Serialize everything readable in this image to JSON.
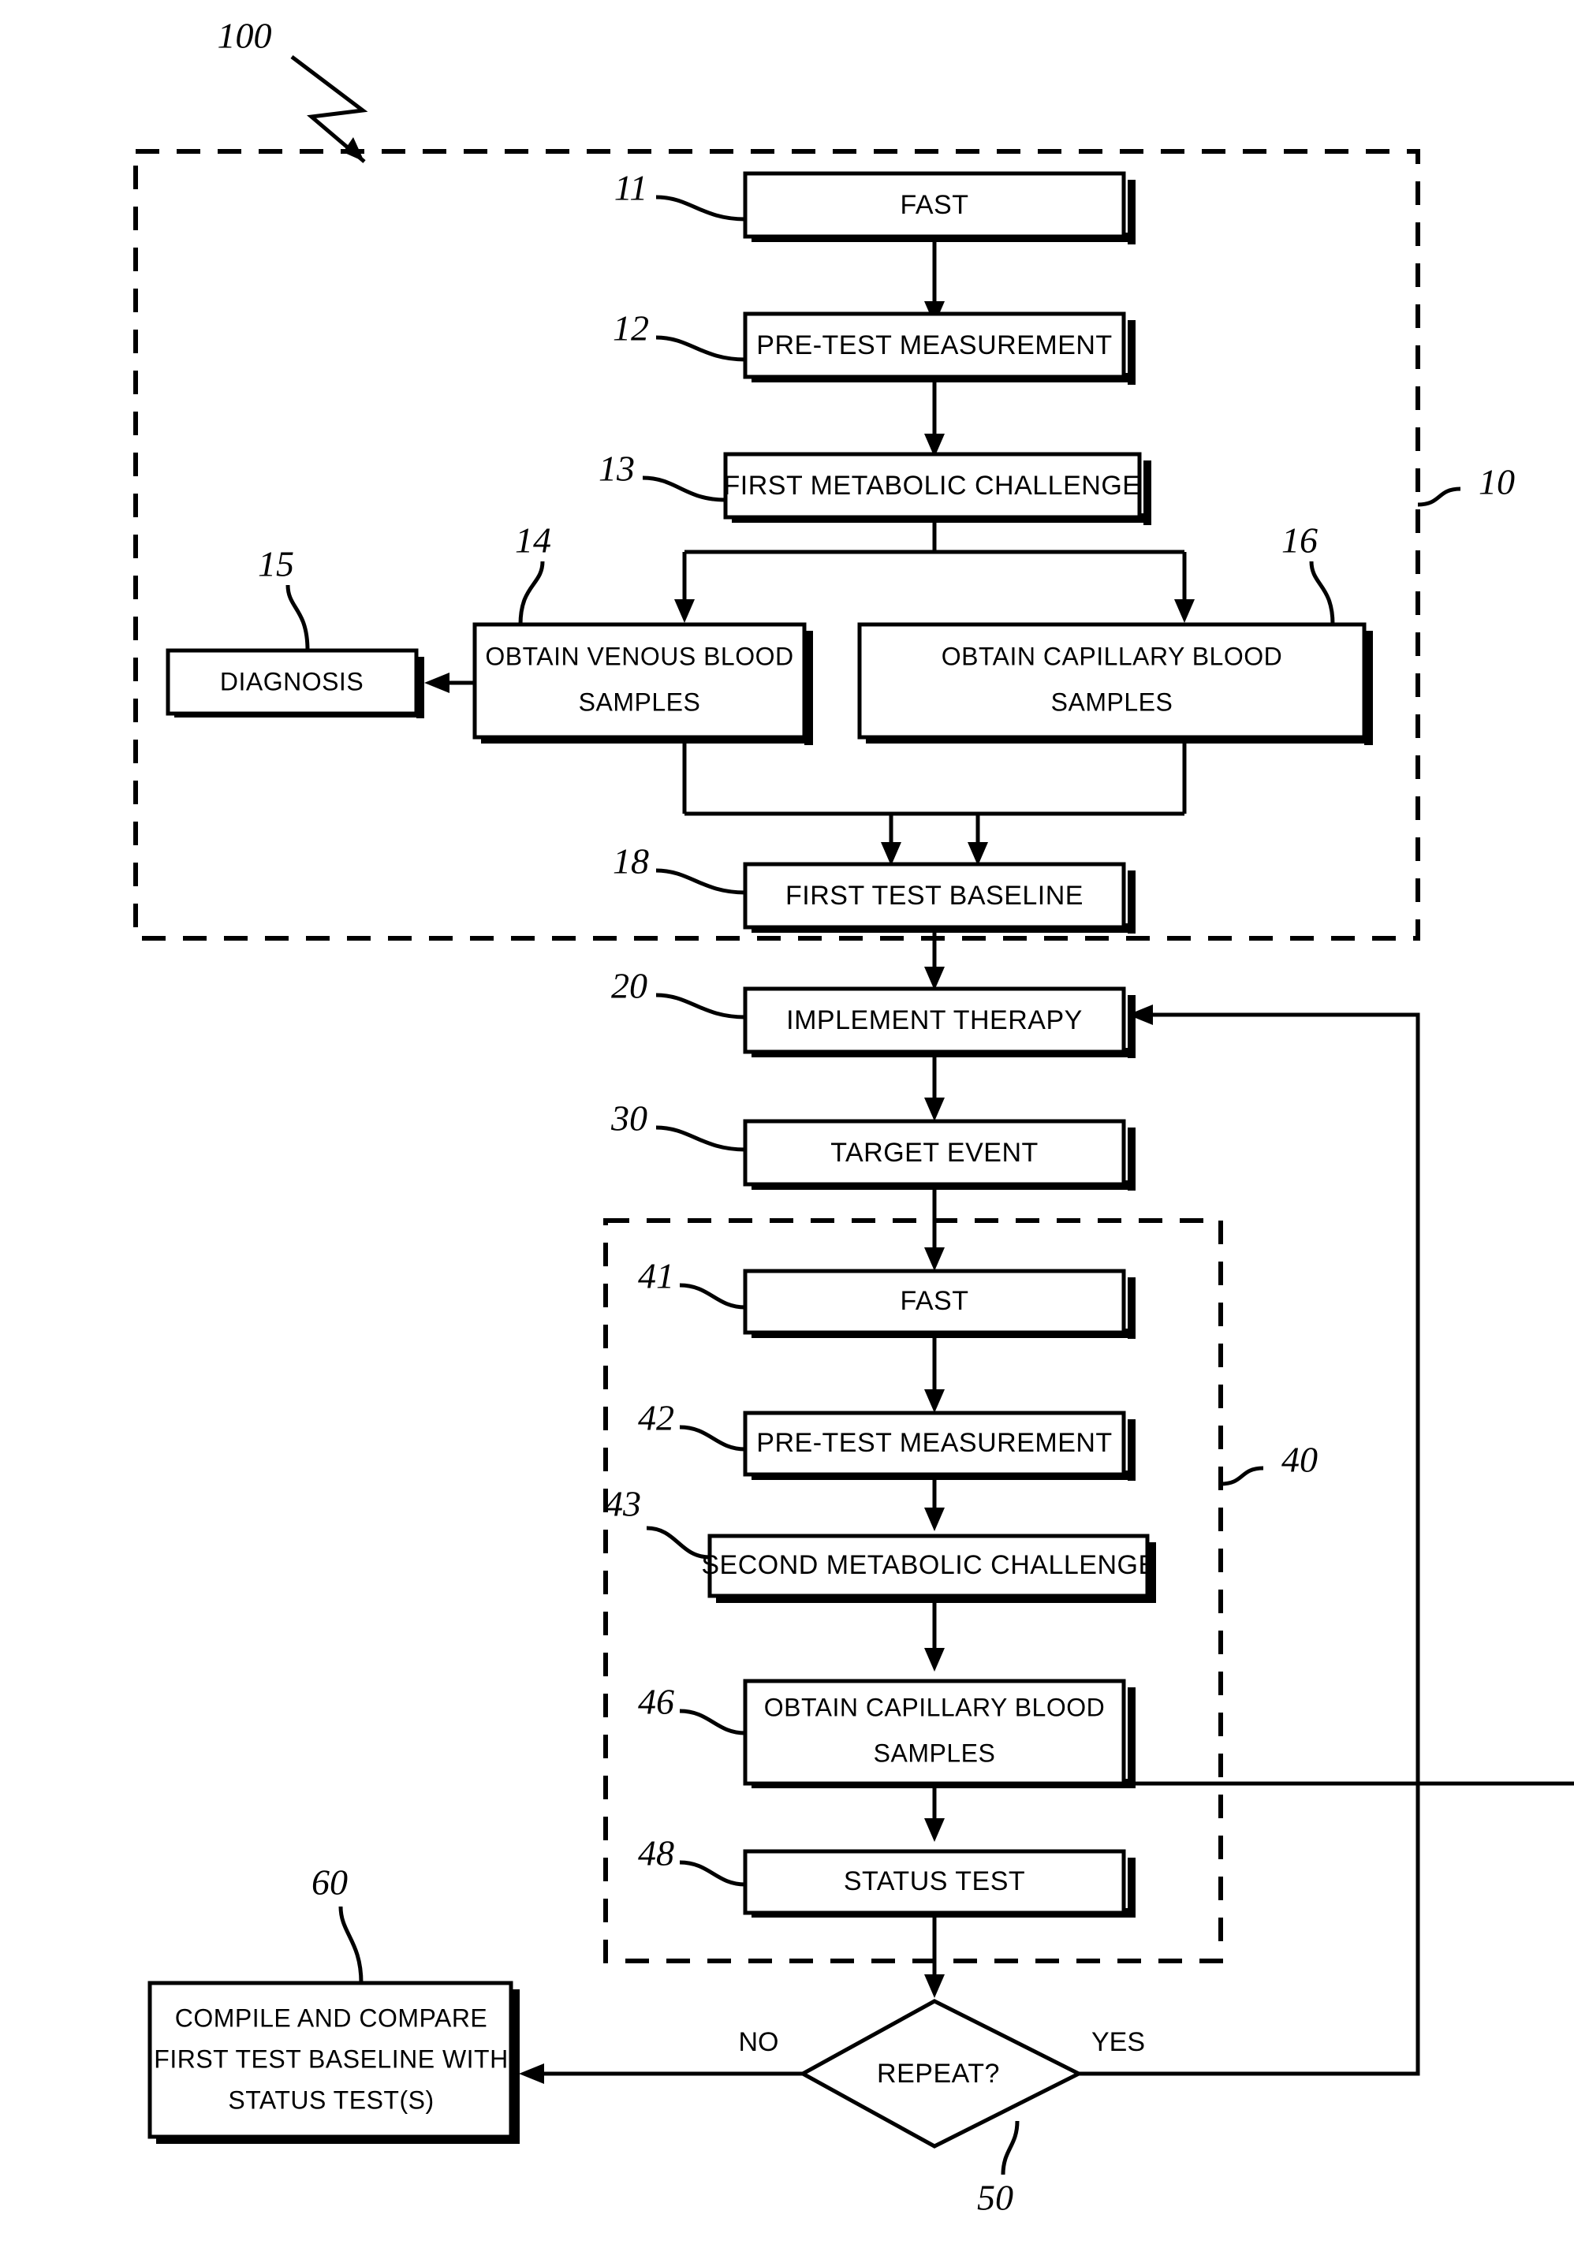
{
  "figure": {
    "figure_ref": "100",
    "outer_region_ref": "10",
    "inner_region_ref": "40"
  },
  "nodes": [
    {
      "id": "n11",
      "ref": "11",
      "label": "FAST",
      "lines": [
        "FAST"
      ]
    },
    {
      "id": "n12",
      "ref": "12",
      "label": "PRE-TEST MEASUREMENT",
      "lines": [
        "PRE-TEST MEASUREMENT"
      ]
    },
    {
      "id": "n13",
      "ref": "13",
      "label": "FIRST METABOLIC CHALLENGE",
      "lines": [
        "FIRST METABOLIC CHALLENGE"
      ]
    },
    {
      "id": "n14",
      "ref": "14",
      "label": "OBTAIN VENOUS BLOOD SAMPLES",
      "lines": [
        "OBTAIN VENOUS BLOOD",
        "SAMPLES"
      ]
    },
    {
      "id": "n15",
      "ref": "15",
      "label": "DIAGNOSIS",
      "lines": [
        "DIAGNOSIS"
      ]
    },
    {
      "id": "n16",
      "ref": "16",
      "label": "OBTAIN CAPILLARY BLOOD SAMPLES",
      "lines": [
        "OBTAIN CAPILLARY BLOOD",
        "SAMPLES"
      ]
    },
    {
      "id": "n18",
      "ref": "18",
      "label": "FIRST TEST BASELINE",
      "lines": [
        "FIRST TEST BASELINE"
      ]
    },
    {
      "id": "n20",
      "ref": "20",
      "label": "IMPLEMENT THERAPY",
      "lines": [
        "IMPLEMENT THERAPY"
      ]
    },
    {
      "id": "n30",
      "ref": "30",
      "label": "TARGET EVENT",
      "lines": [
        "TARGET EVENT"
      ]
    },
    {
      "id": "n41",
      "ref": "41",
      "label": "FAST",
      "lines": [
        "FAST"
      ]
    },
    {
      "id": "n42",
      "ref": "42",
      "label": "PRE-TEST MEASUREMENT",
      "lines": [
        "PRE-TEST MEASUREMENT"
      ]
    },
    {
      "id": "n43",
      "ref": "43",
      "label": "SECOND METABOLIC CHALLENGE",
      "lines": [
        "SECOND METABOLIC CHALLENGE"
      ]
    },
    {
      "id": "n46",
      "ref": "46",
      "label": "OBTAIN CAPILLARY BLOOD SAMPLES",
      "lines": [
        "OBTAIN CAPILLARY BLOOD",
        "SAMPLES"
      ]
    },
    {
      "id": "n48",
      "ref": "48",
      "label": "STATUS TEST",
      "lines": [
        "STATUS TEST"
      ]
    },
    {
      "id": "n50",
      "ref": "50",
      "label": "REPEAT?",
      "lines": [
        "REPEAT?"
      ]
    },
    {
      "id": "n60",
      "ref": "60",
      "label": "COMPILE AND COMPARE FIRST TEST BASELINE WITH STATUS TEST(S)",
      "lines": [
        "COMPILE AND COMPARE",
        "FIRST TEST BASELINE WITH",
        "STATUS TEST(S)"
      ]
    }
  ],
  "branch_labels": {
    "no": "NO",
    "yes": "YES"
  },
  "colors": {
    "stroke": "#000000",
    "fill": "#ffffff"
  }
}
